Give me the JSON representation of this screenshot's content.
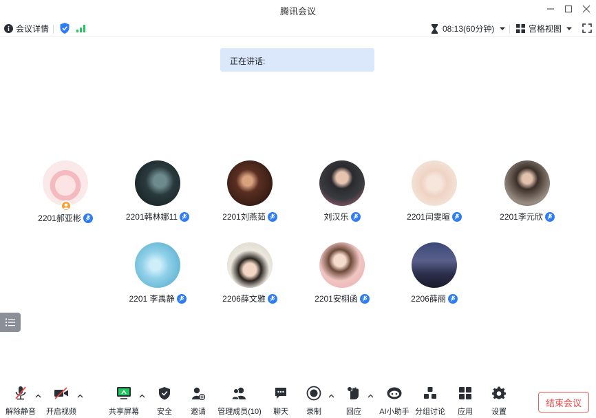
{
  "window": {
    "title": "腾讯会议"
  },
  "infobar": {
    "meeting_info_label": "会议详情",
    "timer": "08:13(60分钟)",
    "view_label": "宫格视图"
  },
  "speaking": {
    "label": "正在讲话:"
  },
  "participants": [
    {
      "name": "2201郝亚彬",
      "is_host": true
    },
    {
      "name": "2201韩林娜11"
    },
    {
      "name": "2201刘燕茹"
    },
    {
      "name": "刘汉乐"
    },
    {
      "name": "2201闫雯暄"
    },
    {
      "name": "2201李元欣"
    },
    {
      "name": "2201 李禹静"
    },
    {
      "name": "2206薛文雅"
    },
    {
      "name": "2201安栩函"
    },
    {
      "name": "2206薛丽"
    }
  ],
  "toolbar": {
    "unmute": "解除静音",
    "start_video": "开启视频",
    "share_screen": "共享屏幕",
    "security": "安全",
    "invite": "邀请",
    "manage_members": "管理成员(10)",
    "chat": "聊天",
    "record": "录制",
    "reactions": "回应",
    "ai_assistant": "AI小助手",
    "breakout": "分组讨论",
    "apps": "应用",
    "settings": "设置",
    "end_meeting": "结束会议"
  },
  "colors": {
    "accent": "#2f7df6",
    "signal": "#22c55e",
    "end": "#ef4444",
    "speaking_bg": "#dbe8fb"
  }
}
